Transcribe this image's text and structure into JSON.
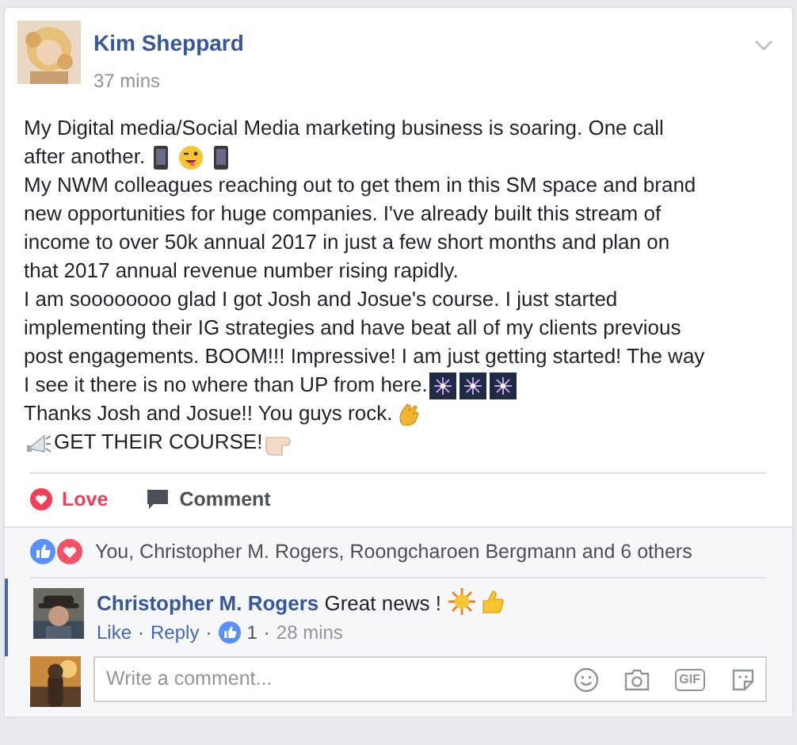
{
  "post": {
    "author": "Kim Sheppard",
    "time": "37 mins",
    "avatar": {
      "kind": "picture"
    },
    "paragraphs": [
      [
        {
          "kind": "text",
          "text": "My Digital media/Social Media marketing business is soaring. One call"
        }
      ],
      [
        {
          "kind": "text",
          "text": "after another. "
        },
        {
          "kind": "phone"
        },
        {
          "kind": "wink"
        },
        {
          "kind": "phone"
        }
      ],
      [
        {
          "kind": "text",
          "text": "My NWM colleagues reaching out to get them in this SM space and brand"
        }
      ],
      [
        {
          "kind": "text",
          "text": "new opportunities for huge companies. I've already built this stream of"
        }
      ],
      [
        {
          "kind": "text",
          "text": "income to over 50k annual 2017 in just a few short months and plan on"
        }
      ],
      [
        {
          "kind": "text",
          "text": "that 2017 annual revenue number rising rapidly."
        }
      ],
      [
        {
          "kind": "text",
          "text": "I am soooooooo glad I got Josh and Josue's course. I just started"
        }
      ],
      [
        {
          "kind": "text",
          "text": "implementing their IG strategies and have beat all of my clients previous"
        }
      ],
      [
        {
          "kind": "text",
          "text": "post engagements. BOOM!!! Impressive! I am just getting started! The way"
        }
      ],
      [
        {
          "kind": "text",
          "text": "I see it there is no where than UP from here. "
        },
        {
          "kind": "fireworks"
        },
        {
          "kind": "fireworks"
        },
        {
          "kind": "fireworks"
        }
      ],
      [
        {
          "kind": "text",
          "text": "Thanks Josh and Josue!! You guys rock. "
        },
        {
          "kind": "clap"
        }
      ],
      [
        {
          "kind": "megaphone"
        },
        {
          "kind": "text",
          "text": "GET THEIR COURSE!"
        },
        {
          "kind": "point"
        }
      ]
    ]
  },
  "actions": [
    {
      "label": "Love",
      "kind": "love",
      "selected": true
    },
    {
      "label": "Comment",
      "kind": "comment",
      "selected": false
    }
  ],
  "reactions": {
    "text": "You, Christopher M. Rogers, Roongcharoen Bergmann and 6 others"
  },
  "comments": [
    {
      "author": "Christopher M. Rogers",
      "text": "Great news ! ",
      "meta_like": "Like",
      "sep_1": "·",
      "meta_reply": "Reply",
      "sep_2": "·",
      "likes": "1",
      "sep_3": "·",
      "time": "28 mins"
    }
  ],
  "composer": {
    "placeholder": "Write a comment...",
    "gif_label": "GIF"
  }
}
